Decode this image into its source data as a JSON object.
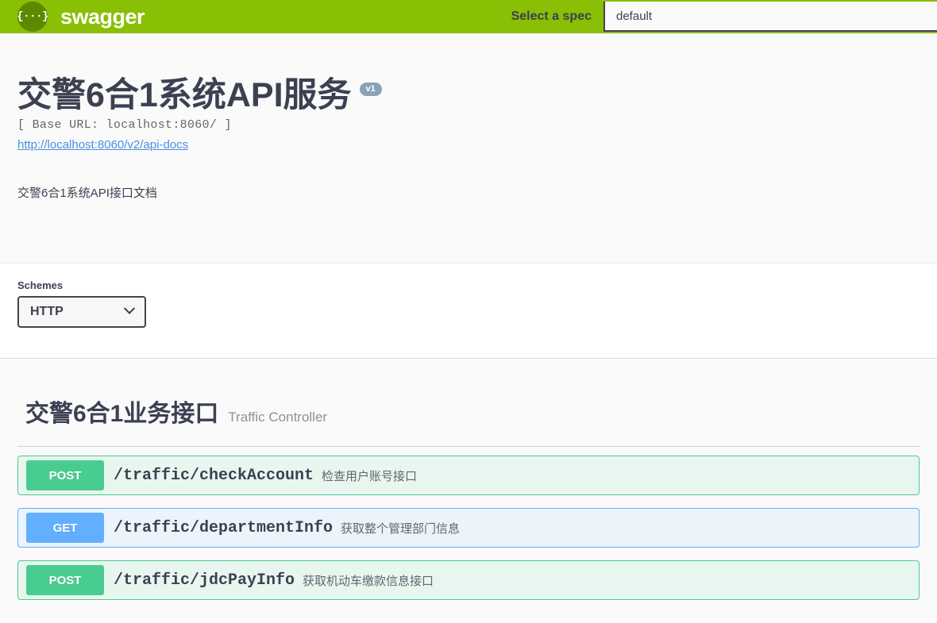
{
  "topbar": {
    "logo_glyph": "{···}",
    "logo_text": "swagger",
    "select_spec_label": "Select a spec",
    "spec_value": "default"
  },
  "info": {
    "title": "交警6合1系统API服务",
    "version_badge": "v1",
    "base_url": "[ Base URL: localhost:8060/ ]",
    "docs_link": "http://localhost:8060/v2/api-docs",
    "description": "交警6合1系统API接口文档"
  },
  "schemes": {
    "label": "Schemes",
    "selected": "HTTP"
  },
  "tag": {
    "name": "交警6合1业务接口",
    "description": "Traffic Controller"
  },
  "operations": [
    {
      "method": "POST",
      "method_class": "post",
      "path": "/traffic/checkAccount",
      "summary": "检查用户账号接口"
    },
    {
      "method": "GET",
      "method_class": "get",
      "path": "/traffic/departmentInfo",
      "summary": "获取整个管理部门信息"
    },
    {
      "method": "POST",
      "method_class": "post",
      "path": "/traffic/jdcPayInfo",
      "summary": "获取机动车缴款信息接口"
    }
  ],
  "colors": {
    "header_green": "#89bf04",
    "logo_dark_green": "#5b8a00",
    "post_green": "#49cc90",
    "get_blue": "#61affe",
    "link_blue": "#4990e2",
    "version_gray": "#89a2b6",
    "text_dark": "#3b4151"
  }
}
